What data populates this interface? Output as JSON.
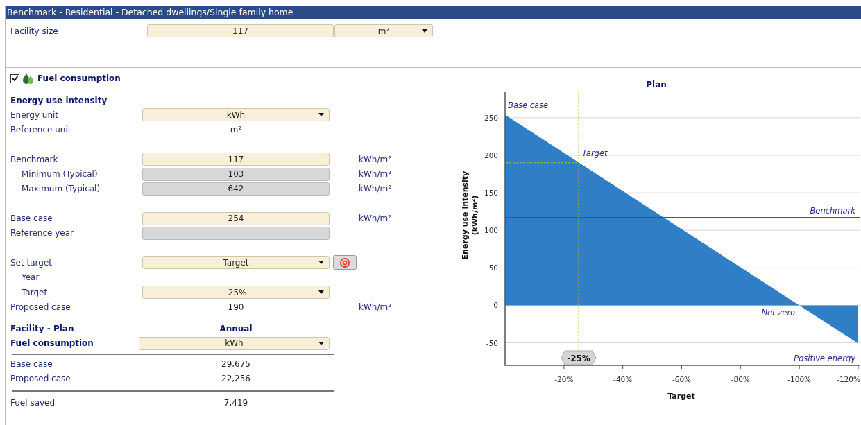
{
  "window": {
    "title": "Benchmark - Residential - Detached dwellings/Single family home"
  },
  "facility_size": {
    "label": "Facility size",
    "value": "117",
    "unit": "m²"
  },
  "fuel_section": {
    "checked": true,
    "title": "Fuel consumption"
  },
  "eui": {
    "heading": "Energy use intensity",
    "groups": [
      [
        {
          "label": "Energy unit",
          "kind": "dropdown",
          "value": "kWh"
        },
        {
          "label": "Reference unit",
          "kind": "text",
          "value": "m²"
        }
      ],
      [
        {
          "label": "Benchmark",
          "kind": "input",
          "value": "117",
          "unit": "kWh/m²",
          "children": [
            {
              "label": "Minimum (Typical)",
              "kind": "readonly",
              "value": "103",
              "unit": "kWh/m²"
            },
            {
              "label": "Maximum (Typical)",
              "kind": "readonly",
              "value": "642",
              "unit": "kWh/m²"
            }
          ]
        }
      ],
      [
        {
          "label": "Base case",
          "kind": "input",
          "value": "254",
          "unit": "kWh/m²"
        },
        {
          "label": "Reference year",
          "kind": "readonly"
        }
      ],
      [
        {
          "label": "Set target",
          "kind": "dropdown-button",
          "value": "Target",
          "children": [
            {
              "label": "Year",
              "kind": "label"
            },
            {
              "label": "Target",
              "kind": "dropdown",
              "value": "-25%"
            }
          ]
        },
        {
          "label": "Proposed case",
          "kind": "text",
          "value": "190",
          "unit": "kWh/m²"
        }
      ]
    ]
  },
  "plan": {
    "title": "Facility - Plan",
    "column": "Annual",
    "unit_label": "Fuel consumption",
    "unit": "kWh",
    "rows": [
      {
        "label": "Base case",
        "value": "29,675"
      },
      {
        "label": "Proposed case",
        "value": "22,256"
      }
    ],
    "total": {
      "label": "Fuel saved",
      "value": "7,419"
    }
  },
  "chart": {
    "chart_data": {
      "type": "area",
      "title": "Plan",
      "xlabel": "Target",
      "ylabel": "Energy use intensity (kWh/m²)",
      "x": [
        0,
        -120
      ],
      "series": [
        {
          "color": "#2f7ec6",
          "values": [
            254,
            -51
          ]
        }
      ],
      "ref_lines": [
        {
          "axis": "y",
          "value": 117,
          "label": "Benchmark",
          "color": "#b22a3a"
        },
        {
          "axis": "x",
          "value": -25,
          "color": "#9acd32"
        }
      ],
      "grid": true,
      "xlim": [
        0,
        -120
      ],
      "ylim": [
        -80,
        285
      ],
      "xticks": [
        {
          "value": -20,
          "label": "-20%"
        },
        {
          "value": -40,
          "label": "-40%"
        },
        {
          "value": -60,
          "label": "-60%"
        },
        {
          "value": -80,
          "label": "-80%"
        },
        {
          "value": -100,
          "label": "-100%"
        },
        {
          "value": -120,
          "label": "-120%"
        }
      ],
      "yticks": [
        -50,
        0,
        50,
        100,
        150,
        200,
        250
      ],
      "annotations": [
        {
          "text": "Base case",
          "x": 0,
          "y": 254
        },
        {
          "text": "Target",
          "x": -25,
          "y": 190
        },
        {
          "text": "Net zero",
          "x": -100,
          "y": 0
        },
        "Positive energy",
        "-25%"
      ]
    }
  }
}
